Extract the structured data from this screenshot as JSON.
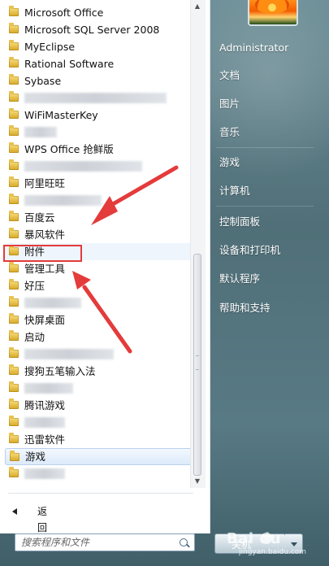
{
  "programs": {
    "items": [
      {
        "label": "Microsoft Office",
        "blur": false
      },
      {
        "label": "Microsoft SQL Server 2008",
        "blur": false
      },
      {
        "label": "MyEclipse",
        "blur": false
      },
      {
        "label": "Rational Software",
        "blur": false
      },
      {
        "label": "Sybase",
        "blur": false
      },
      {
        "label": "",
        "blur": true,
        "blur_width": 175
      },
      {
        "label": "WiFiMasterKey",
        "blur": false
      },
      {
        "label": "",
        "blur": true,
        "blur_width": 40
      },
      {
        "label": "WPS Office 抢鲜版",
        "blur": false
      },
      {
        "label": "",
        "blur": true,
        "blur_width": 145
      },
      {
        "label": "阿里旺旺",
        "blur": false
      },
      {
        "label": "",
        "blur": true,
        "blur_width": 95
      },
      {
        "label": "百度云",
        "blur": false
      },
      {
        "label": "暴风软件",
        "blur": false
      },
      {
        "label": "附件",
        "blur": false
      },
      {
        "label": "管理工具",
        "blur": false
      },
      {
        "label": "好压",
        "blur": false
      },
      {
        "label": "",
        "blur": true,
        "blur_width": 70
      },
      {
        "label": "快屏桌面",
        "blur": false
      },
      {
        "label": "启动",
        "blur": false
      },
      {
        "label": "",
        "blur": true,
        "blur_width": 110
      },
      {
        "label": "搜狗五笔输入法",
        "blur": false
      },
      {
        "label": "",
        "blur": true,
        "blur_width": 60
      },
      {
        "label": "腾讯游戏",
        "blur": false
      },
      {
        "label": "",
        "blur": true,
        "blur_width": 50
      },
      {
        "label": "迅雷软件",
        "blur": false
      },
      {
        "label": "游戏",
        "blur": false
      },
      {
        "label": "",
        "blur": true,
        "blur_width": 50
      }
    ],
    "selected_index": 14,
    "hover_index": 26
  },
  "footer": {
    "back_label": "返回",
    "search_placeholder": "搜索程序和文件"
  },
  "right_panel": {
    "items": [
      "Administrator",
      "文档",
      "图片",
      "音乐",
      "游戏",
      "计算机",
      "控制面板",
      "设备和打印机",
      "默认程序",
      "帮助和支持"
    ]
  },
  "shutdown": {
    "label": "关机"
  },
  "watermark": {
    "main": "Bai du",
    "sub": "jingyan.baidu.com"
  },
  "colors": {
    "highlight": "#e43b3b",
    "right_text": "#ffffff"
  }
}
